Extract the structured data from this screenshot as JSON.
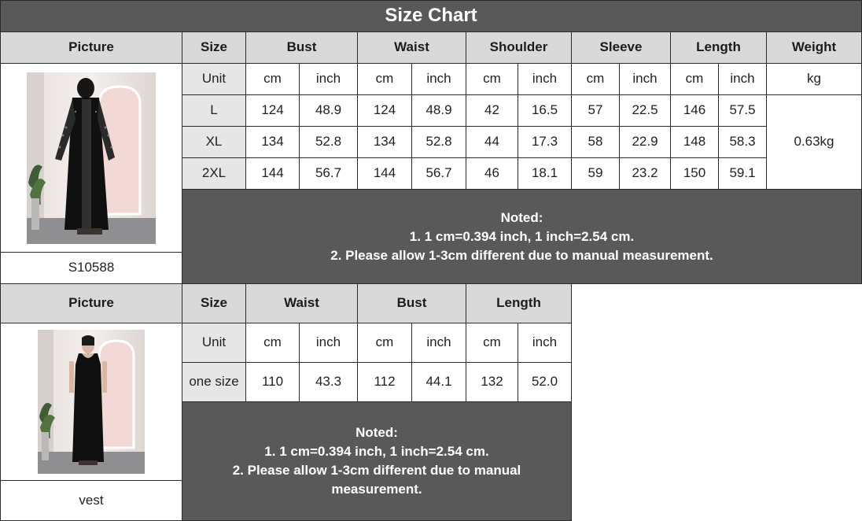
{
  "title": "Size Chart",
  "table1": {
    "headers": {
      "picture": "Picture",
      "size": "Size",
      "groups": [
        "Bust",
        "Waist",
        "Shoulder",
        "Sleeve",
        "Length"
      ],
      "weight": "Weight"
    },
    "unit_row": {
      "label": "Unit",
      "units": [
        "cm",
        "inch",
        "cm",
        "inch",
        "cm",
        "inch",
        "cm",
        "inch",
        "cm",
        "inch"
      ],
      "weight_unit": "kg"
    },
    "rows": [
      {
        "size": "L",
        "values": [
          "124",
          "48.9",
          "124",
          "48.9",
          "42",
          "16.5",
          "57",
          "22.5",
          "146",
          "57.5"
        ]
      },
      {
        "size": "XL",
        "values": [
          "134",
          "52.8",
          "134",
          "52.8",
          "44",
          "17.3",
          "58",
          "22.9",
          "148",
          "58.3"
        ]
      },
      {
        "size": "2XL",
        "values": [
          "144",
          "56.7",
          "144",
          "56.7",
          "46",
          "18.1",
          "59",
          "23.2",
          "150",
          "59.1"
        ]
      }
    ],
    "weight": "0.63kg",
    "item_code": "S10588",
    "note": {
      "heading": "Noted:",
      "line1": "1. 1 cm=0.394 inch, 1 inch=2.54 cm.",
      "line2": "2. Please allow 1-3cm different due to manual measurement."
    }
  },
  "table2": {
    "headers": {
      "picture": "Picture",
      "size": "Size",
      "groups": [
        "Waist",
        "Bust",
        "Length"
      ]
    },
    "unit_row": {
      "label": "Unit",
      "units": [
        "cm",
        "inch",
        "cm",
        "inch",
        "cm",
        "inch"
      ]
    },
    "rows": [
      {
        "size": "one size",
        "values": [
          "110",
          "43.3",
          "112",
          "44.1",
          "132",
          "52.0"
        ]
      }
    ],
    "item_code": "vest",
    "note": {
      "heading": "Noted:",
      "line1": "1. 1 cm=0.394 inch, 1 inch=2.54 cm.",
      "line2a": "2. Please allow 1-3cm different due to manual",
      "line2b": "measurement."
    }
  }
}
